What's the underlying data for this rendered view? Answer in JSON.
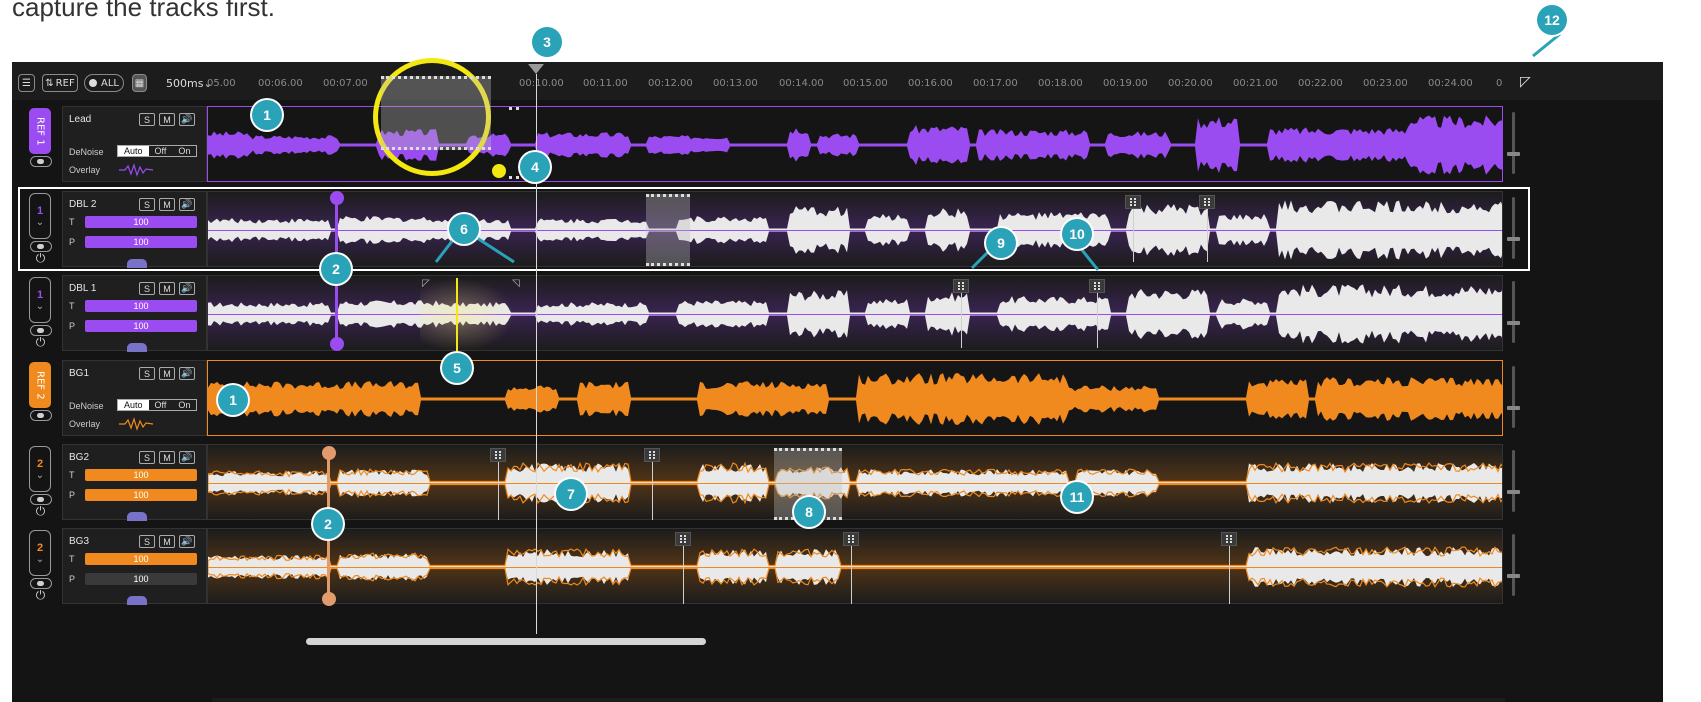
{
  "caption": "capture the tracks first.",
  "toolbar": {
    "ref_label": "REF",
    "all_label": "ALL",
    "zoom_label": "500ms",
    "timeline_ticks": [
      "05.00",
      "00:06.00",
      "00:07.00",
      "00:10.00",
      "00:11.00",
      "00:12.00",
      "00:13.00",
      "00:14.00",
      "00:15.00",
      "00:16.00",
      "00:17.00",
      "00:18.00",
      "00:19.00",
      "00:20.00",
      "00:21.00",
      "00:22.00",
      "00:23.00",
      "00:24.00",
      "0"
    ]
  },
  "tracks": [
    {
      "name": "Lead",
      "ref_label": "REF 1",
      "kind": "ref",
      "color": "#9a4cf0",
      "denoise_label": "DeNoise",
      "denoise_options": [
        "Auto",
        "Off",
        "On"
      ],
      "denoise_selected": "Auto",
      "overlay_label": "Overlay"
    },
    {
      "name": "DBL 2",
      "group": "1",
      "kind": "dbl",
      "color": "#9a4cf0",
      "t_label": "T",
      "t_value": "100",
      "p_label": "P",
      "p_value": "100"
    },
    {
      "name": "DBL 1",
      "group": "1",
      "kind": "dbl",
      "color": "#9a4cf0",
      "t_label": "T",
      "t_value": "100",
      "p_label": "P",
      "p_value": "100"
    },
    {
      "name": "BG1",
      "ref_label": "REF 2",
      "kind": "ref",
      "color": "#f08a1e",
      "denoise_label": "DeNoise",
      "denoise_options": [
        "Auto",
        "Off",
        "On"
      ],
      "denoise_selected": "Auto",
      "overlay_label": "Overlay"
    },
    {
      "name": "BG2",
      "group": "2",
      "kind": "dbl",
      "color": "#f08a1e",
      "t_label": "T",
      "t_value": "100",
      "p_label": "P",
      "p_value": "100"
    },
    {
      "name": "BG3",
      "group": "2",
      "kind": "dbl",
      "color": "#f08a1e",
      "t_label": "T",
      "t_value": "100",
      "p_label": "P",
      "p_value": "100"
    }
  ],
  "track_buttons": {
    "solo": "S",
    "mute": "M"
  },
  "callouts": [
    "1",
    "2",
    "3",
    "4",
    "5",
    "6",
    "7",
    "8",
    "9",
    "10",
    "11",
    "12",
    "1",
    "2"
  ],
  "colors": {
    "callout": "#2aa2b8",
    "highlight": "#f3e810",
    "purple": "#9a4cf0",
    "orange": "#f08a1e"
  }
}
